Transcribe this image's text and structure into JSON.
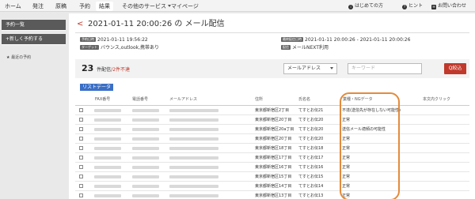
{
  "topnav": {
    "items": [
      "ホーム",
      "発注",
      "原稿",
      "予約",
      "結果",
      "その他のサービス",
      "マイページ"
    ],
    "right": [
      "はじめての方",
      "ヒント",
      "お問い合わせ"
    ]
  },
  "sidebar": {
    "primary": "予約一覧",
    "secondary": "+新しく予約する",
    "link": "★ 最近の予約"
  },
  "page": {
    "back": "<",
    "title": "2021-01-11 20:00:26 の メール配信"
  },
  "meta": {
    "tag1": "予約日時",
    "value1": "2021-01-11 19:56:22",
    "tag2": "ターゲット",
    "value2": "バウンス,outlook,携帯あり",
    "tag3": "最終配信日時",
    "value3": "2021-01-11 20:00:26 - 2021-01-11 20:00:26",
    "tag4": "配信",
    "value4": "メールNEXT利用"
  },
  "summary": {
    "count": "23",
    "count_suffix": "件配信",
    "errors": "/2件不達",
    "select_value": "メールアドレス",
    "keyword_placeholder": "キーワード",
    "filter_button": "Q絞込"
  },
  "list": {
    "tag": "リストデータ",
    "headers": [
      "FAX番号",
      "電話番号",
      "メールアドレス",
      "住所",
      "氏名名",
      "業種・NGデータ",
      "本文内クリック"
    ],
    "rows": [
      {
        "address": "東京都新宿区2丁目",
        "name": "てすとお伝21",
        "status": "不達(送信先が存在しない可能性)"
      },
      {
        "address": "東京都新宿区20丁目",
        "name": "てすとお伝20",
        "status": "正常"
      },
      {
        "address": "東京都新宿区20a丁目",
        "name": "てすとお伝20",
        "status": "送信メール適頻の可能性"
      },
      {
        "address": "東京都新宿区20丁目",
        "name": "てすとお伝20",
        "status": "正常"
      },
      {
        "address": "東京都新宿区18丁目",
        "name": "てすとお伝18",
        "status": "正常"
      },
      {
        "address": "東京都新宿区17丁目",
        "name": "てすとお伝17",
        "status": "正常"
      },
      {
        "address": "東京都新宿区16丁目",
        "name": "てすとお伝16",
        "status": "正常"
      },
      {
        "address": "東京都新宿区15丁目",
        "name": "てすとお伝15",
        "status": "正常"
      },
      {
        "address": "東京都新宿区14丁目",
        "name": "てすとお伝14",
        "status": "正常"
      },
      {
        "address": "東京都新宿区13丁目",
        "name": "てすとお伝13",
        "status": "正常"
      }
    ]
  },
  "colors": {
    "accent": "#c0392b",
    "highlight": "#e38b3c",
    "tag_blue": "#3b6fc6"
  }
}
